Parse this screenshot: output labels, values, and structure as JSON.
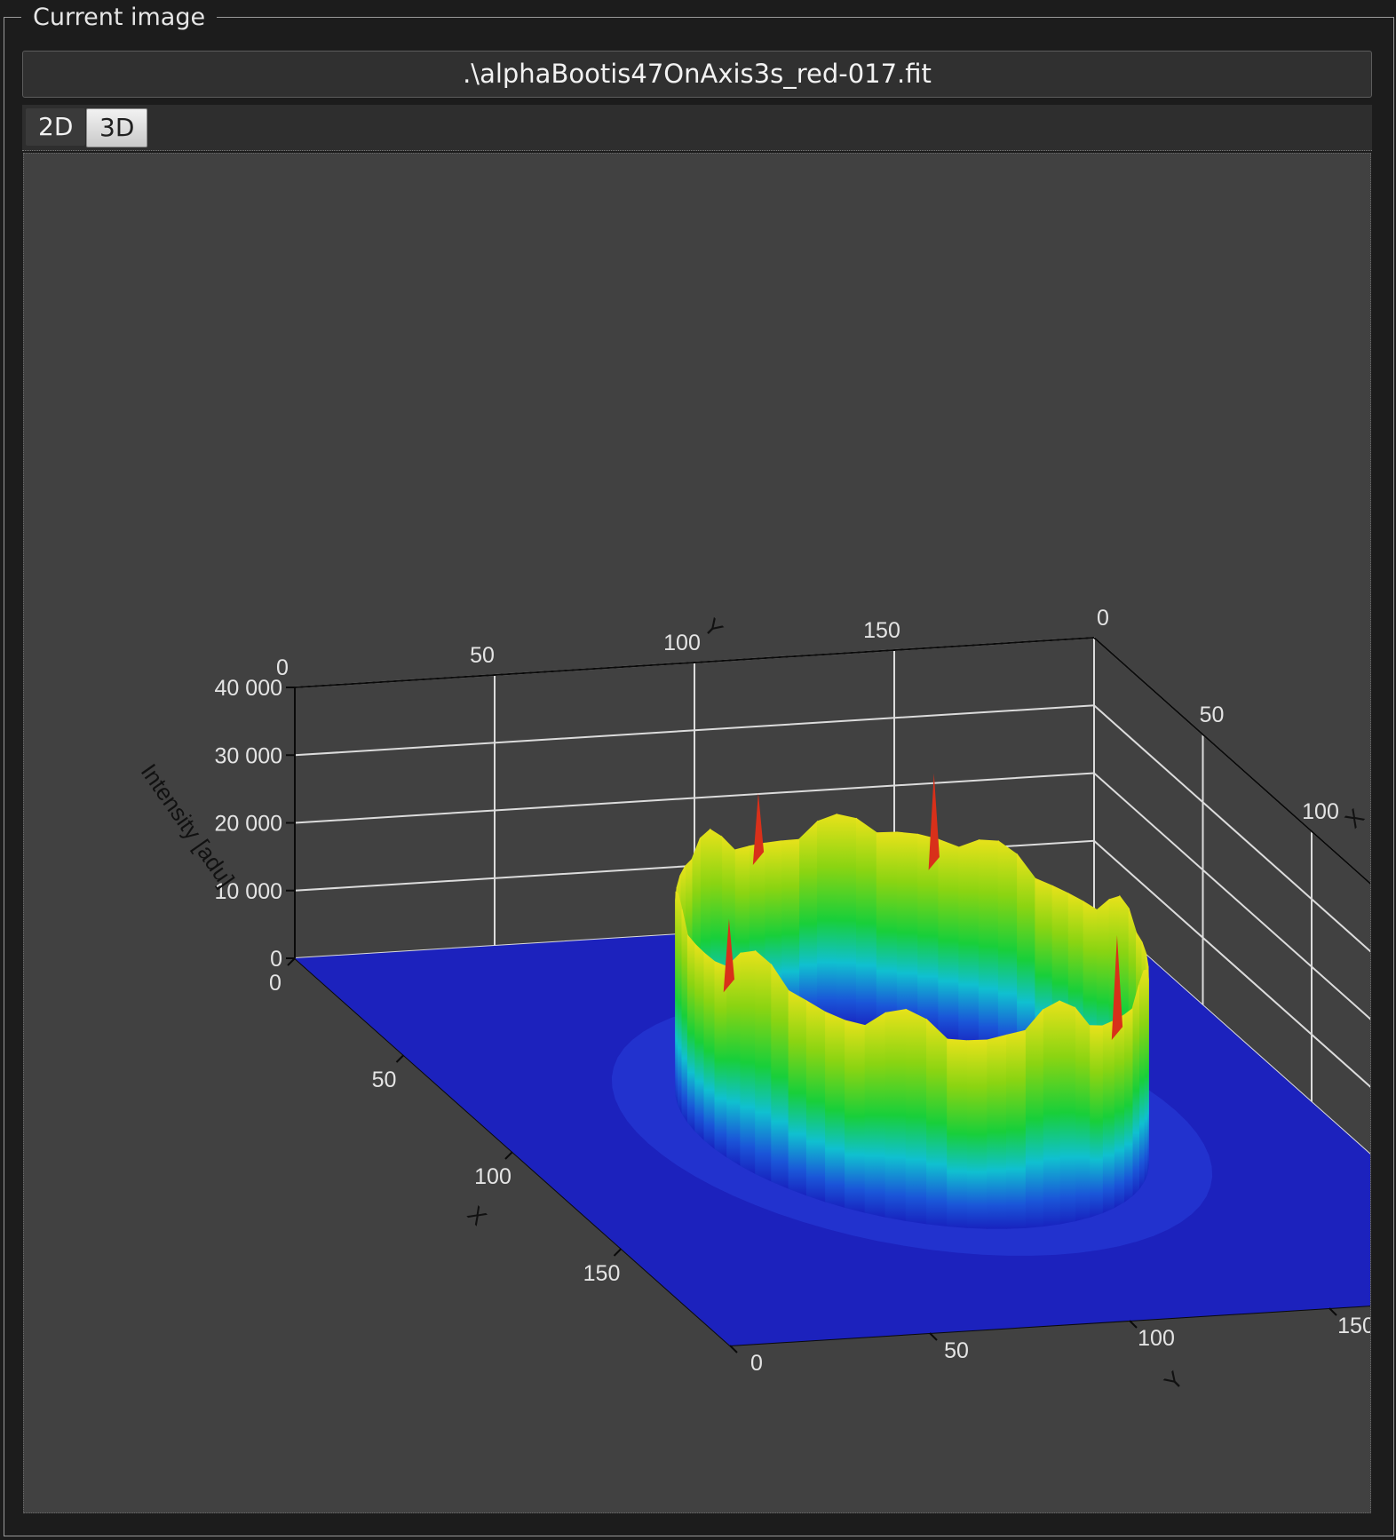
{
  "group": {
    "title": "Current image"
  },
  "file": {
    "name": ".\\alphaBootis47OnAxis3s_red-017.fit"
  },
  "tabs": [
    {
      "label": "2D",
      "selected": false
    },
    {
      "label": "3D",
      "selected": true
    }
  ],
  "colors": {
    "panel_background": "#1c1c1c",
    "plot_background": "#414141",
    "surface_low": "#1820c0",
    "surface_mid": "#00d040",
    "surface_high": "#d01010"
  },
  "chart_data": {
    "type": "surface3d",
    "axes": {
      "x": {
        "label": "X",
        "ticks": [
          "0",
          "50",
          "100",
          "150"
        ],
        "range": [
          0,
          200
        ]
      },
      "y": {
        "label": "Y",
        "ticks": [
          "0",
          "50",
          "100",
          "150"
        ],
        "range": [
          0,
          200
        ]
      },
      "z": {
        "label": "Intensity [adu]",
        "ticks": [
          "0",
          "10 000",
          "20 000",
          "30 000",
          "40 000"
        ],
        "range": [
          0,
          40000
        ]
      }
    },
    "grid": true,
    "surface": {
      "shape": "ring (defocused star donut)",
      "background_level": 0,
      "ring_level": 30000,
      "max_peak": 40000,
      "colormap": [
        "blue",
        "cyan",
        "green",
        "yellow",
        "red"
      ]
    }
  }
}
